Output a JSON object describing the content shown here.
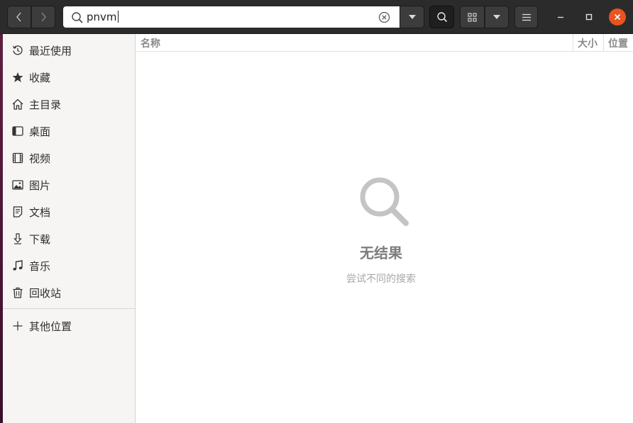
{
  "search": {
    "query": "pnvm"
  },
  "sidebar": {
    "items": [
      {
        "label": "最近使用",
        "icon": "recent-icon"
      },
      {
        "label": "收藏",
        "icon": "star-icon"
      },
      {
        "label": "主目录",
        "icon": "home-icon"
      },
      {
        "label": "桌面",
        "icon": "desktop-icon"
      },
      {
        "label": "视频",
        "icon": "video-icon"
      },
      {
        "label": "图片",
        "icon": "picture-icon"
      },
      {
        "label": "文档",
        "icon": "document-icon"
      },
      {
        "label": "下载",
        "icon": "download-icon"
      },
      {
        "label": "音乐",
        "icon": "music-icon"
      },
      {
        "label": "回收站",
        "icon": "trash-icon"
      }
    ],
    "other_locations": {
      "label": "其他位置",
      "icon": "plus-icon"
    }
  },
  "list_header": {
    "name": "名称",
    "size": "大小",
    "location": "位置"
  },
  "empty_state": {
    "title": "无结果",
    "subtitle": "尝试不同的搜索",
    "icon": "search-icon"
  },
  "colors": {
    "accent_close": "#e95420",
    "header_bg": "#2b2b2b",
    "sidebar_bg": "#f6f5f4"
  }
}
